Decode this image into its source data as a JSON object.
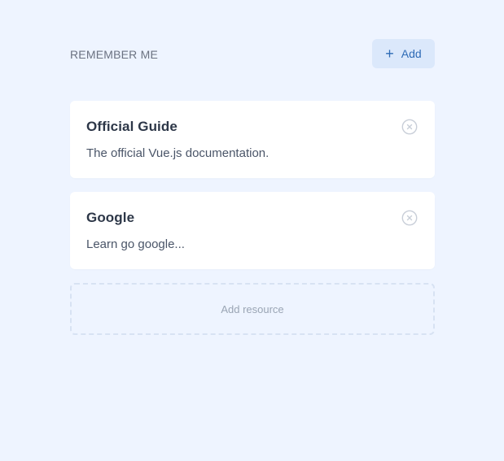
{
  "section": {
    "title": "REMEMBER ME",
    "add_button": {
      "icon": "plus-icon",
      "icon_glyph": "+",
      "label": "Add"
    }
  },
  "resources": [
    {
      "title": "Official Guide",
      "description": "The official Vue.js documentation.",
      "remove_icon": "close-circle-icon"
    },
    {
      "title": "Google",
      "description": "Learn go google...",
      "remove_icon": "close-circle-icon"
    }
  ],
  "add_resource": {
    "label": "Add resource"
  },
  "colors": {
    "background": "#eef4ff",
    "card": "#ffffff",
    "accent": "#2e6bb6",
    "accent_bg": "#dbe8fb",
    "muted_text": "#9aa5b4",
    "dashed_border": "#d7e2f3"
  }
}
